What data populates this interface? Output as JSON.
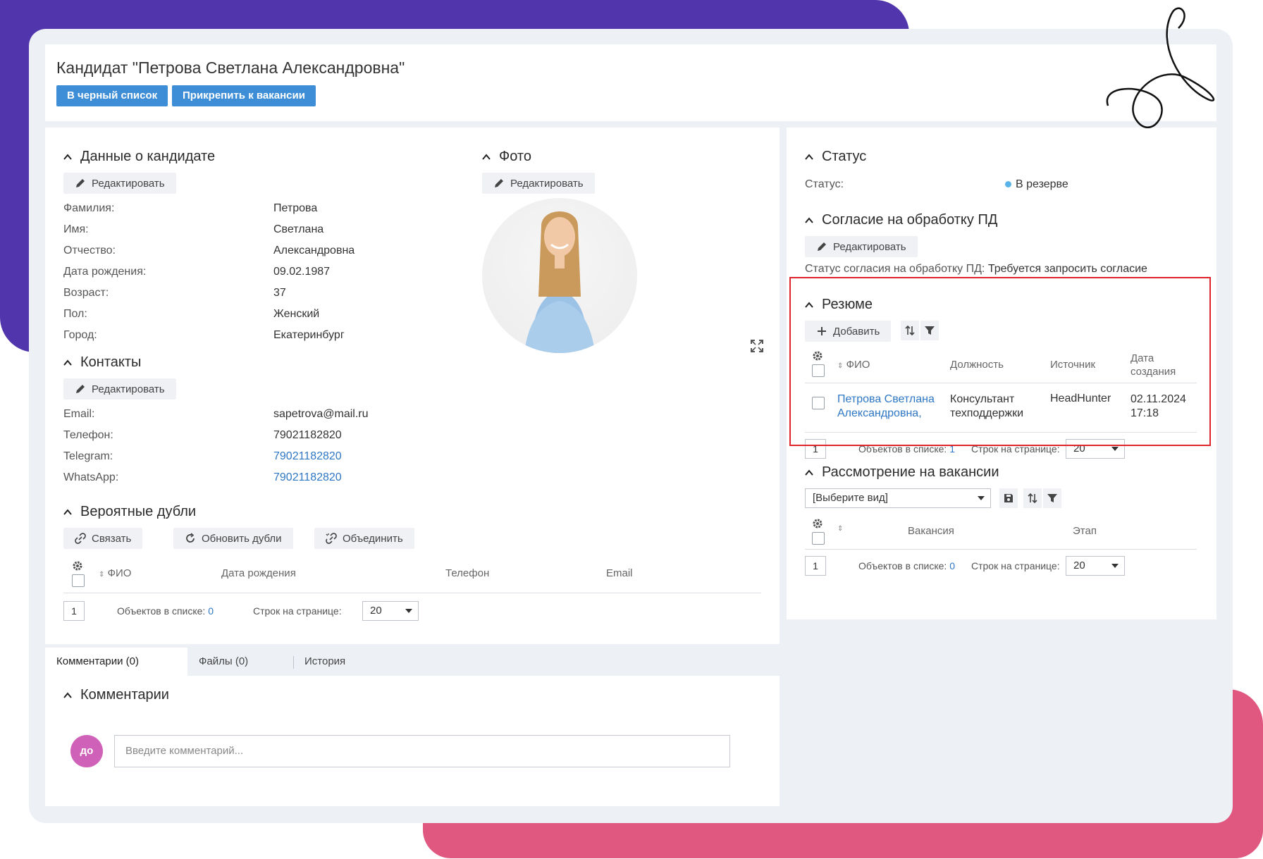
{
  "header": {
    "title": "Кандидат \"Петрова Светлана Александровна\"",
    "blacklist_btn": "В черный список",
    "attach_btn": "Прикрепить к вакансии"
  },
  "candidate": {
    "title": "Данные о кандидате",
    "edit": "Редактировать",
    "fields": [
      {
        "label": "Фамилия:",
        "value": "Петрова"
      },
      {
        "label": "Имя:",
        "value": "Светлана"
      },
      {
        "label": "Отчество:",
        "value": "Александровна"
      },
      {
        "label": "Дата рождения:",
        "value": "09.02.1987"
      },
      {
        "label": "Возраст:",
        "value": "37"
      },
      {
        "label": "Пол:",
        "value": "Женский"
      },
      {
        "label": "Город:",
        "value": "Екатеринбург"
      }
    ]
  },
  "photo": {
    "title": "Фото",
    "edit": "Редактировать"
  },
  "contacts": {
    "title": "Контакты",
    "edit": "Редактировать",
    "fields": [
      {
        "label": "Email:",
        "value": "sapetrova@mail.ru"
      },
      {
        "label": "Телефон:",
        "value": "79021182820"
      },
      {
        "label": "Telegram:",
        "value": "79021182820"
      },
      {
        "label": "WhatsApp:",
        "value": "79021182820"
      }
    ]
  },
  "duplicates": {
    "title": "Вероятные дубли",
    "link_btn": "Связать",
    "refresh_btn": "Обновить дубли",
    "merge_btn": "Объединить",
    "columns": [
      "ФИО",
      "Дата рождения",
      "Телефон",
      "Email"
    ],
    "page": "1",
    "count_label": "Объектов в списке:",
    "count": "0",
    "rows_label": "Строк на странице:",
    "rows": "20"
  },
  "tabs": [
    "Комментарии (0)",
    "Файлы (0)",
    "История"
  ],
  "comments": {
    "title": "Комментарии",
    "avatar": "до",
    "placeholder": "Введите комментарий..."
  },
  "status": {
    "title": "Статус",
    "label": "Статус:",
    "value": "В резерве"
  },
  "consent": {
    "title": "Согласие на обработку ПД",
    "edit": "Редактировать",
    "label": "Статус согласия на обработку ПД:",
    "value": "Требуется запросить согласие"
  },
  "resume": {
    "title": "Резюме",
    "add_btn": "Добавить",
    "columns": [
      "ФИО",
      "Должность",
      "Источник",
      "Дата создания"
    ],
    "rows": [
      {
        "fio": "Петрова Светлана Александровна,",
        "position": "Консультант техподдержки",
        "source": "HeadHunter",
        "date": "02.11.2024 17:18"
      }
    ],
    "page": "1",
    "count_label": "Объектов в списке:",
    "count": "1",
    "rows_label": "Строк на странице:",
    "rows_per_page": "20"
  },
  "vacancies": {
    "title": "Рассмотрение на вакансии",
    "view_select": "[Выберите вид]",
    "columns": [
      "Вакансия",
      "Этап"
    ],
    "page": "1",
    "count_label": "Объектов в списке:",
    "count": "0",
    "rows_label": "Строк на странице:",
    "rows_per_page": "20"
  },
  "colors": {
    "primary_button": "#3d8ed6",
    "highlight_box": "#e0242d",
    "link": "#2e77c4",
    "deco_purple": "#5135ad",
    "deco_pink": "#e05780",
    "avatar": "#cf62b8"
  }
}
